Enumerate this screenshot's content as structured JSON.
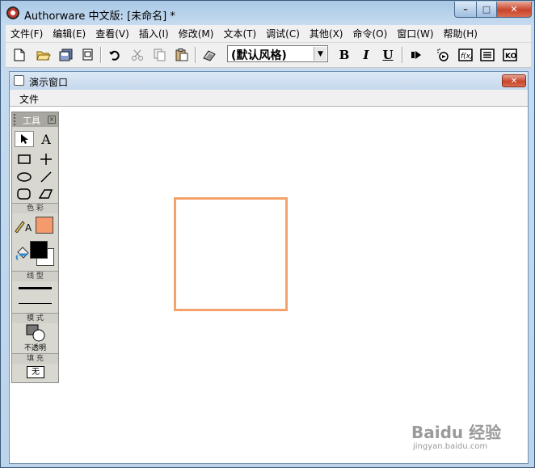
{
  "window": {
    "title": "Authorware 中文版: [未命名] *",
    "controls": {
      "minimize": "–",
      "maximize": "□",
      "close": "✕"
    }
  },
  "menubar": {
    "items": [
      "文件(F)",
      "编辑(E)",
      "查看(V)",
      "插入(I)",
      "修改(M)",
      "文本(T)",
      "调试(C)",
      "其他(X)",
      "命令(O)",
      "窗口(W)",
      "帮助(H)"
    ]
  },
  "toolbar": {
    "style_combo_value": "(默认风格)",
    "bold": "B",
    "italic": "I",
    "underline": "U",
    "icons": [
      "new-icon",
      "open-icon",
      "save-all-icon",
      "import-icon",
      "undo-icon",
      "cut-icon",
      "copy-icon",
      "paste-icon",
      "find-icon",
      "bold-icon",
      "italic-icon",
      "underline-icon",
      "restart-icon",
      "control-panel-icon",
      "functions-icon",
      "variables-icon",
      "knowledge-objects-icon"
    ]
  },
  "presentation_window": {
    "title": "演示窗口",
    "menu_file": "文件",
    "close": "✕"
  },
  "tool_palette": {
    "title": "工具",
    "close": "⊠",
    "section_color": "色 彩",
    "section_line": "线 型",
    "section_mode": "模 式",
    "mode_value": "不透明",
    "section_fill": "填 充",
    "fill_value": "无",
    "text_tool": "A",
    "fill_color": "#f49a6c",
    "stroke_color": "#000000",
    "bg_color": "#ffffff"
  },
  "canvas": {
    "rectangle_stroke_color": "#f4a26b"
  },
  "watermark": {
    "text": "Baidu 经验",
    "url": "jingyan.baidu.com"
  }
}
